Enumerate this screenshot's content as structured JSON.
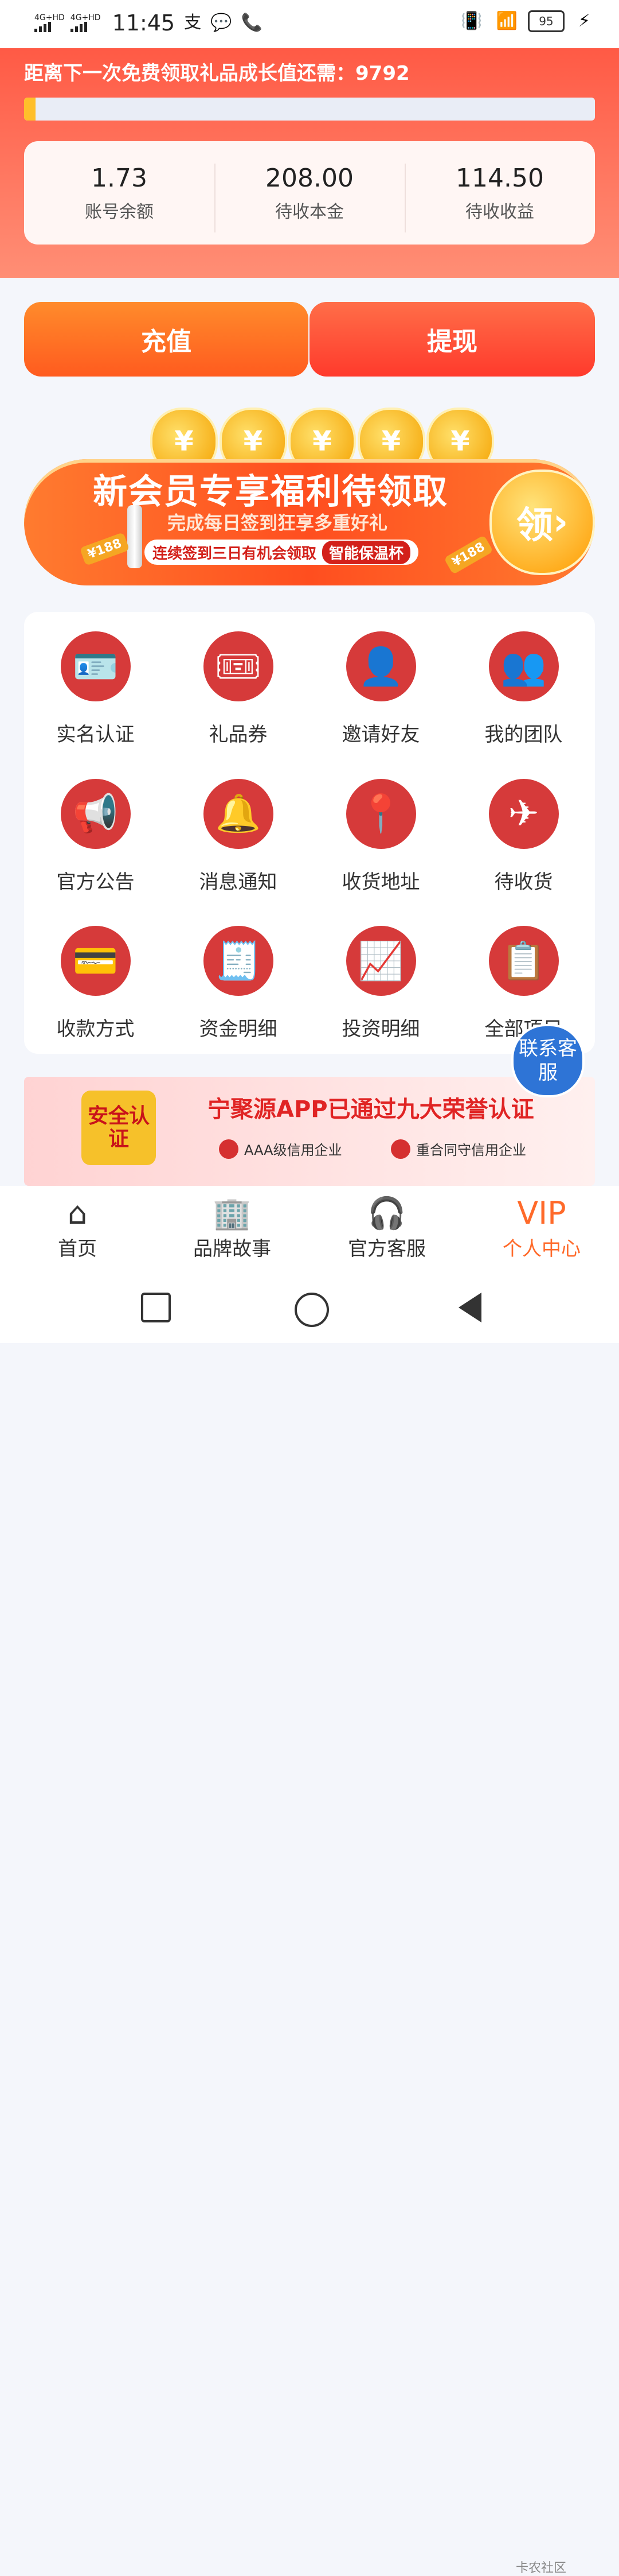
{
  "status_bar": {
    "carrier1": "4G+HD",
    "carrier2": "4G+HD",
    "time": "11:45",
    "battery": "95"
  },
  "growth": {
    "text": "距离下一次免费领取礼品成长值还需：9792",
    "progress": 0.02
  },
  "stats": [
    {
      "value": "1.73",
      "label": "账号余额"
    },
    {
      "value": "208.00",
      "label": "待收本金"
    },
    {
      "value": "114.50",
      "label": "待收收益"
    }
  ],
  "actions": {
    "recharge": "充值",
    "withdraw": "提现"
  },
  "promo": {
    "coin_symbol": "¥",
    "title": "新会员专享福利待领取",
    "subtitle": "完成每日签到狂享多重好礼",
    "tag_text": "连续签到三日有机会领取",
    "tag_pill": "智能保温杯",
    "claim": "领",
    "claim_arrow": "›",
    "yen_left": "¥188",
    "yen_right": "¥188"
  },
  "grid_items": [
    {
      "label": "实名认证",
      "icon": "id-card-shield-icon",
      "glyph": "🪪"
    },
    {
      "label": "礼品券",
      "icon": "coupon-icon",
      "glyph": "🎟"
    },
    {
      "label": "邀请好友",
      "icon": "invite-friend-icon",
      "glyph": "👤"
    },
    {
      "label": "我的团队",
      "icon": "team-icon",
      "glyph": "👥"
    },
    {
      "label": "官方公告",
      "icon": "announcement-icon",
      "glyph": "📢"
    },
    {
      "label": "消息通知",
      "icon": "bell-icon",
      "glyph": "🔔"
    },
    {
      "label": "收货地址",
      "icon": "location-pin-icon",
      "glyph": "📍"
    },
    {
      "label": "待收货",
      "icon": "airplane-delivery-icon",
      "glyph": "✈"
    },
    {
      "label": "收款方式",
      "icon": "credit-card-icon",
      "glyph": "💳"
    },
    {
      "label": "资金明细",
      "icon": "calculator-document-icon",
      "glyph": "🧾"
    },
    {
      "label": "投资明细",
      "icon": "investment-chart-icon",
      "glyph": "📈"
    },
    {
      "label": "全部项目",
      "icon": "clipboard-gear-icon",
      "glyph": "📋"
    }
  ],
  "bottom_banner": {
    "badge": "安全认证",
    "title": "宁聚源APP已通过九大荣誉认证",
    "cert1": "AAA级信用企业",
    "cert2": "重合同守信用企业"
  },
  "fab": {
    "label": "联系客服"
  },
  "tabs": [
    {
      "label": "首页",
      "icon": "home-icon",
      "glyph": "⌂",
      "active": false
    },
    {
      "label": "品牌故事",
      "icon": "building-icon",
      "glyph": "🏢",
      "active": false
    },
    {
      "label": "官方客服",
      "icon": "headset-icon",
      "glyph": "🎧",
      "active": false
    },
    {
      "label": "个人中心",
      "icon": "vip-hand-icon",
      "glyph": "VIP",
      "active": true
    }
  ],
  "watermark": "卡农社区"
}
